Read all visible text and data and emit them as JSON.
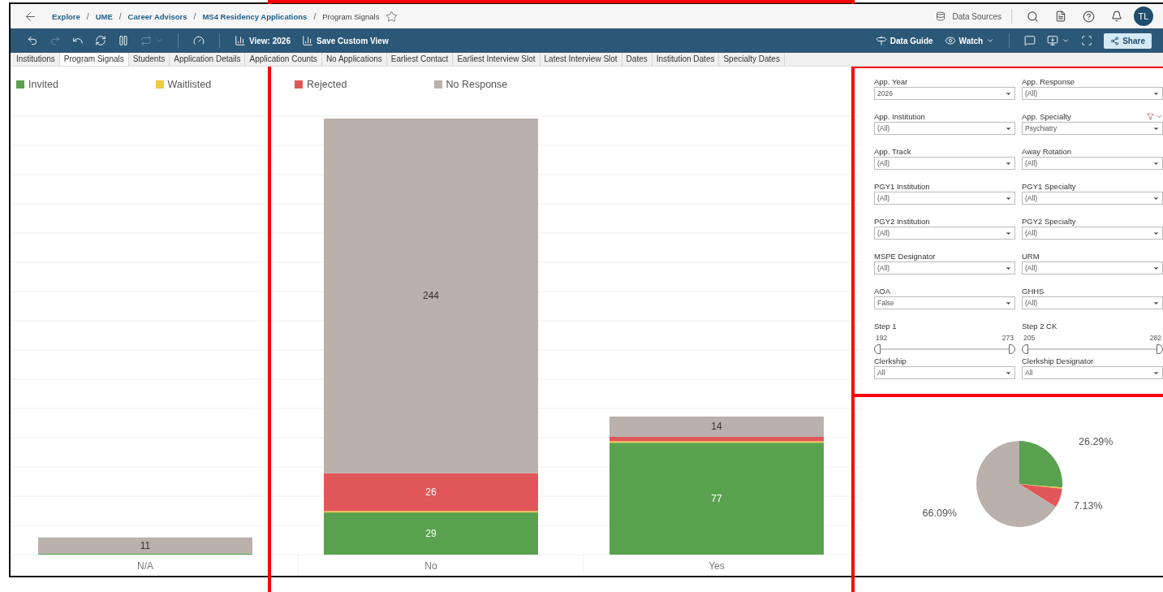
{
  "breadcrumbs": [
    {
      "label": "Explore",
      "kind": "link"
    },
    {
      "label": "UME",
      "kind": "link",
      "separator": "/"
    },
    {
      "label": "Career Advisors",
      "kind": "link",
      "separator": "/"
    },
    {
      "label": "MS4 Residency Applications",
      "kind": "link",
      "separator": "/"
    },
    {
      "label": "Program Signals",
      "kind": "current",
      "separator": "/"
    }
  ],
  "top_actions": {
    "data_sources": "Data Sources",
    "avatar": "TL"
  },
  "toolbar": {
    "view": "View: 2026",
    "save_view": "Save Custom View",
    "data_guide": "Data Guide",
    "watch": "Watch",
    "share": "Share",
    "replay_disabled": true
  },
  "tabs": [
    {
      "label": "Institutions",
      "selected": false
    },
    {
      "label": "Program Signals",
      "selected": true
    },
    {
      "label": "Students",
      "selected": false
    },
    {
      "label": "Application Details",
      "selected": false
    },
    {
      "label": "Application Counts",
      "selected": false
    },
    {
      "label": "No Applications",
      "selected": false
    },
    {
      "label": "Earliest Contact",
      "selected": false
    },
    {
      "label": "Earliest Interview Slot",
      "selected": false
    },
    {
      "label": "Latest Interview Slot",
      "selected": false
    },
    {
      "label": "Dates",
      "selected": false
    },
    {
      "label": "Institution Dates",
      "selected": false
    },
    {
      "label": "Specialty Dates",
      "selected": false
    }
  ],
  "bar_chart": {
    "chart_data": {
      "type": "bar",
      "stacked": true,
      "orientation": "vertical",
      "categories": [
        "N/A",
        "No",
        "Yes"
      ],
      "series": [
        {
          "name": "Invited",
          "color": "#59a14f",
          "values": [
            0.4,
            29,
            77
          ],
          "value_labels": [
            null,
            "29",
            "77"
          ]
        },
        {
          "name": "Waitlisted",
          "color": "#edc948",
          "values": [
            null,
            1,
            1
          ],
          "value_labels": [
            null,
            null,
            null
          ]
        },
        {
          "name": "Rejected",
          "color": "#e15759",
          "values": [
            null,
            26,
            3
          ],
          "value_labels": [
            null,
            "26",
            null
          ]
        },
        {
          "name": "No Response",
          "color": "#bab0ac",
          "values": [
            11,
            244,
            14
          ],
          "value_labels": [
            "11",
            "244",
            "14"
          ]
        }
      ]
    }
  },
  "filters": [
    {
      "kind": "dropdown",
      "label": "App. Year",
      "value": "2026",
      "clearable": false
    },
    {
      "kind": "dropdown",
      "label": "App. Response",
      "value": "(All)",
      "clearable": false
    },
    {
      "kind": "dropdown",
      "label": "App. Institution",
      "value": "(All)",
      "clearable": false
    },
    {
      "kind": "dropdown",
      "label": "App. Specialty",
      "value": "Psychiatry",
      "clearable": true
    },
    {
      "kind": "dropdown",
      "label": "App. Track",
      "value": "(All)",
      "clearable": false
    },
    {
      "kind": "dropdown",
      "label": "Away Rotation",
      "value": "(All)",
      "clearable": false
    },
    {
      "kind": "dropdown",
      "label": "PGY1 Institution",
      "value": "(All)",
      "clearable": false
    },
    {
      "kind": "dropdown",
      "label": "PGY1 Specialty",
      "value": "(All)",
      "clearable": false
    },
    {
      "kind": "dropdown",
      "label": "PGY2 Institution",
      "value": "(All)",
      "clearable": false
    },
    {
      "kind": "dropdown",
      "label": "PGY2 Specialty",
      "value": "(All)",
      "clearable": false
    },
    {
      "kind": "dropdown",
      "label": "MSPE Designator",
      "value": "(All)",
      "clearable": false
    },
    {
      "kind": "dropdown",
      "label": "URM",
      "value": "(All)",
      "clearable": false
    },
    {
      "kind": "dropdown",
      "label": "AOA",
      "value": "False",
      "clearable": false
    },
    {
      "kind": "dropdown",
      "label": "GHHS",
      "value": "(All)",
      "clearable": false
    },
    {
      "kind": "slider",
      "label": "Step 1",
      "min": "192",
      "max": "273",
      "level": 1
    },
    {
      "kind": "slider",
      "label": "Step 2 CK",
      "min": "205",
      "max": "282",
      "level": 1
    },
    {
      "kind": "dropdown",
      "label": "Clerkship",
      "value": "All",
      "clearable": false
    },
    {
      "kind": "dropdown",
      "label": "Clerkship Designator",
      "value": "All",
      "clearable": false
    }
  ],
  "pie_chart": {
    "chart_data": {
      "type": "pie",
      "values": [
        26.29,
        0.49,
        7.13,
        66.09
      ],
      "value_labels": [
        "26.29%",
        null,
        "7.13%",
        "66.09%"
      ]
    }
  }
}
